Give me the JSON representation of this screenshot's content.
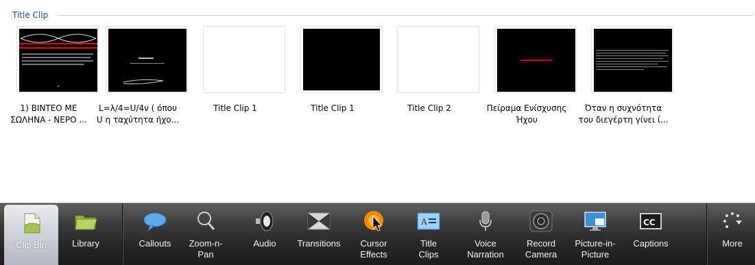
{
  "section": {
    "title": "Title Clip"
  },
  "clips": [
    {
      "line1": "1) ΒΙΝΤΕΟ ΜΕ",
      "line2": "ΣΩΛΗΝΑ - ΝΕΡΟ ...",
      "thumb": "dark"
    },
    {
      "line1": "L=λ/4=U/4ν  ( όπου",
      "line2": "U η ταχύτητα ήχο...",
      "thumb": "dark"
    },
    {
      "line1": "Title Clip 1",
      "line2": "",
      "thumb": "light"
    },
    {
      "line1": "Title Clip 1",
      "line2": "",
      "thumb": "dark"
    },
    {
      "line1": "Title Clip 2",
      "line2": "",
      "thumb": "light"
    },
    {
      "line1": "Πείραμα Ενίσχυσης",
      "line2": "Ήχου",
      "thumb": "dark"
    },
    {
      "line1": "Όταν η συχνότητα",
      "line2": "του διεγέρτη γίνει ί...",
      "thumb": "dark"
    }
  ],
  "toolbar": {
    "items": [
      {
        "id": "clip-bin",
        "line1": "Clip Bin",
        "line2": "",
        "icon": "clip-bin-icon",
        "active": true
      },
      {
        "id": "library",
        "line1": "Library",
        "line2": "",
        "icon": "folder-icon"
      },
      {
        "id": "callouts",
        "line1": "Callouts",
        "line2": "",
        "icon": "speech-bubble-icon"
      },
      {
        "id": "zoom-n-pan",
        "line1": "Zoom-n-",
        "line2": "Pan",
        "icon": "magnifier-icon"
      },
      {
        "id": "audio",
        "line1": "Audio",
        "line2": "",
        "icon": "speaker-icon"
      },
      {
        "id": "transitions",
        "line1": "Transitions",
        "line2": "",
        "icon": "transitions-icon"
      },
      {
        "id": "cursor-effects",
        "line1": "Cursor",
        "line2": "Effects",
        "icon": "cursor-highlight-icon"
      },
      {
        "id": "title-clips",
        "line1": "Title",
        "line2": "Clips",
        "icon": "title-text-icon"
      },
      {
        "id": "voice-narration",
        "line1": "Voice",
        "line2": "Narration",
        "icon": "microphone-icon"
      },
      {
        "id": "record-camera",
        "line1": "Record",
        "line2": "Camera",
        "icon": "camera-lens-icon"
      },
      {
        "id": "picture-in-picture",
        "line1": "Picture-in-",
        "line2": "Picture",
        "icon": "monitor-icon"
      },
      {
        "id": "captions",
        "line1": "Captions",
        "line2": "",
        "icon": "cc-icon"
      },
      {
        "id": "more",
        "line1": "More",
        "line2": "",
        "icon": "more-dots-icon"
      }
    ]
  },
  "colors": {
    "section_title": "#1f4e9e",
    "toolbar_bg": "#262626",
    "accent_red": "#cc0000"
  }
}
